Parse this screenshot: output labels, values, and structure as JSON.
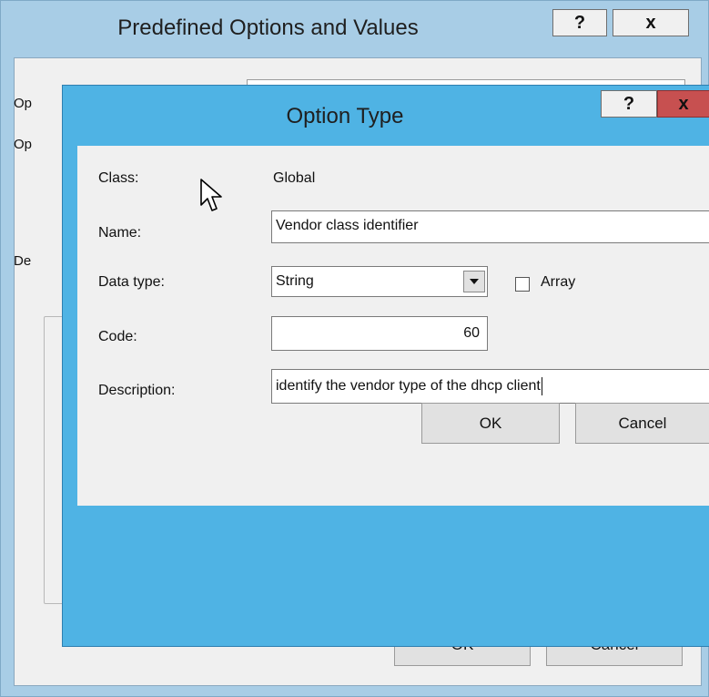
{
  "background_dialog": {
    "title": "Predefined Options and Values",
    "help_button": "?",
    "close_button": "x",
    "labels": [
      "Op",
      "Op",
      "De"
    ],
    "ok_label": "OK",
    "cancel_label": "Cancel"
  },
  "option_type_dialog": {
    "title": "Option Type",
    "help_button": "?",
    "close_button": "x",
    "fields": {
      "class_label": "Class:",
      "class_value": "Global",
      "name_label": "Name:",
      "name_value": "Vendor class identifier",
      "data_type_label": "Data type:",
      "data_type_value": "String",
      "array_label": "Array",
      "array_checked": false,
      "code_label": "Code:",
      "code_value": "60",
      "description_label": "Description:",
      "description_value": "identify the vendor type of the dhcp client"
    },
    "ok_label": "OK",
    "cancel_label": "Cancel"
  },
  "colors": {
    "title_bar": "#4fb3e4",
    "inactive_title_bar": "#a8cde6",
    "close_red": "#c75050",
    "dialog_bg": "#f0f0f0"
  }
}
